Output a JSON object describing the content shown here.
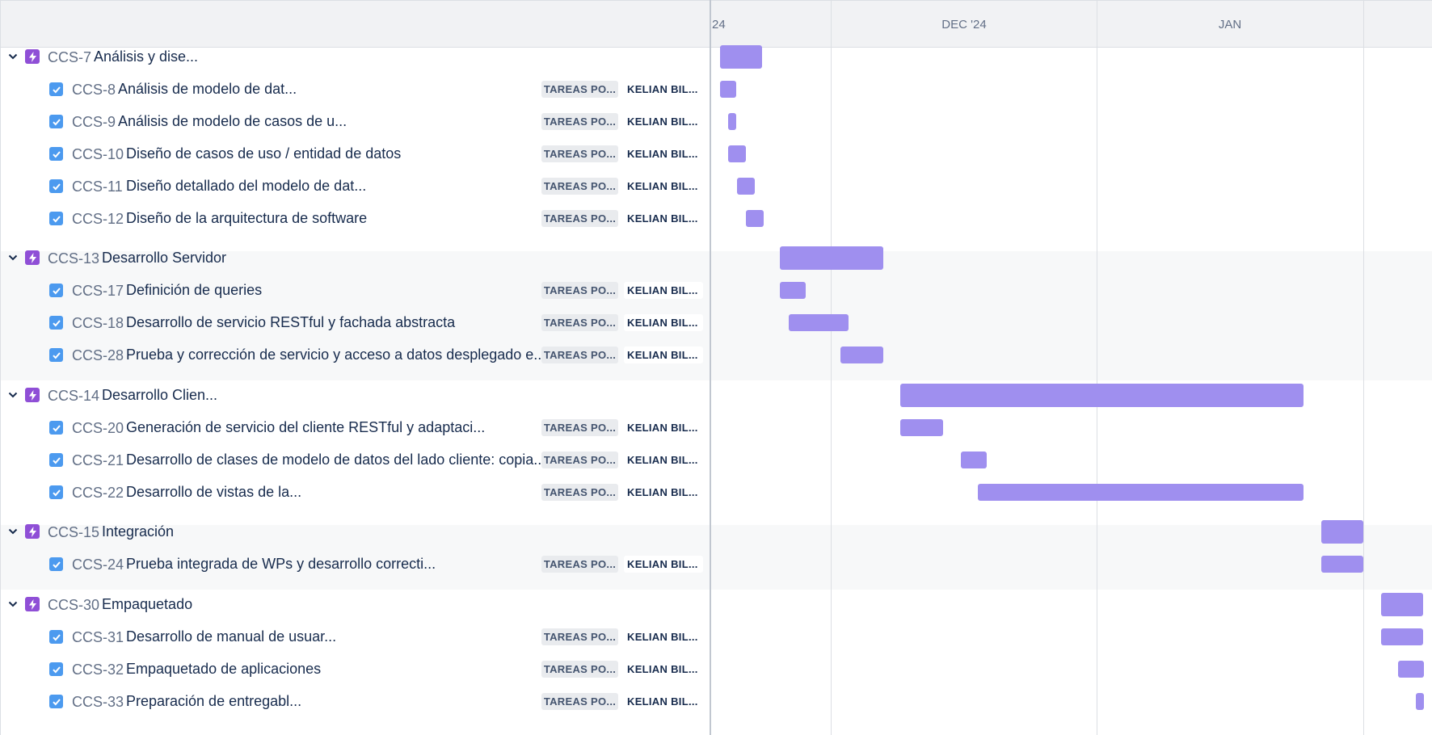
{
  "timeline": {
    "months": [
      "24",
      "DEC '24",
      "JAN"
    ],
    "bar_color": "#9f8fef",
    "epic_icon_color": "#8f4fd6",
    "task_icon_color": "#4c9aef"
  },
  "groups": [
    {
      "key": "CCS-7",
      "title": "Análisis y dise...",
      "shaded": false,
      "tasks": [
        {
          "key": "CCS-8",
          "title": "Análisis de modelo de dat...",
          "status": "TAREAS PO...",
          "assignee": "KELIAN BIL..."
        },
        {
          "key": "CCS-9",
          "title": "Análisis de modelo de casos de u...",
          "status": "TAREAS PO...",
          "assignee": "KELIAN BIL..."
        },
        {
          "key": "CCS-10",
          "title": "Diseño de casos de uso / entidad de datos",
          "status": "TAREAS PO...",
          "assignee": "KELIAN BIL..."
        },
        {
          "key": "CCS-11",
          "title": "Diseño detallado del modelo de dat...",
          "status": "TAREAS PO...",
          "assignee": "KELIAN BIL..."
        },
        {
          "key": "CCS-12",
          "title": "Diseño de la arquitectura de software",
          "status": "TAREAS PO...",
          "assignee": "KELIAN BIL..."
        }
      ]
    },
    {
      "key": "CCS-13",
      "title": "Desarrollo Servidor",
      "shaded": true,
      "tasks": [
        {
          "key": "CCS-17",
          "title": "Definición de queries",
          "status": "TAREAS PO...",
          "assignee": "KELIAN BIL..."
        },
        {
          "key": "CCS-18",
          "title": "Desarrollo de servicio RESTful y fachada abstracta",
          "status": "TAREAS PO...",
          "assignee": "KELIAN BIL..."
        },
        {
          "key": "CCS-28",
          "title": "Prueba y corrección de servicio y acceso a datos desplegado e...",
          "status": "TAREAS PO...",
          "assignee": "KELIAN BIL..."
        }
      ]
    },
    {
      "key": "CCS-14",
      "title": "Desarrollo Clien...",
      "shaded": false,
      "tasks": [
        {
          "key": "CCS-20",
          "title": "Generación de servicio del cliente RESTful y adaptaci...",
          "status": "TAREAS PO...",
          "assignee": "KELIAN BIL..."
        },
        {
          "key": "CCS-21",
          "title": "Desarrollo de clases de modelo de datos del lado cliente: copia...",
          "status": "TAREAS PO...",
          "assignee": "KELIAN BIL..."
        },
        {
          "key": "CCS-22",
          "title": "Desarrollo de vistas de la...",
          "status": "TAREAS PO...",
          "assignee": "KELIAN BIL..."
        }
      ]
    },
    {
      "key": "CCS-15",
      "title": "Integración",
      "shaded": true,
      "tasks": [
        {
          "key": "CCS-24",
          "title": "Prueba integrada de WPs y desarrollo correcti...",
          "status": "TAREAS PO...",
          "assignee": "KELIAN BIL..."
        }
      ]
    },
    {
      "key": "CCS-30",
      "title": "Empaquetado",
      "shaded": false,
      "tasks": [
        {
          "key": "CCS-31",
          "title": "Desarrollo de manual de usuar...",
          "status": "TAREAS PO...",
          "assignee": "KELIAN BIL..."
        },
        {
          "key": "CCS-32",
          "title": "Empaquetado de aplicaciones",
          "status": "TAREAS PO...",
          "assignee": "KELIAN BIL..."
        },
        {
          "key": "CCS-33",
          "title": "Preparación de entregabl...",
          "status": "TAREAS PO...",
          "assignee": "KELIAN BIL..."
        }
      ]
    }
  ]
}
